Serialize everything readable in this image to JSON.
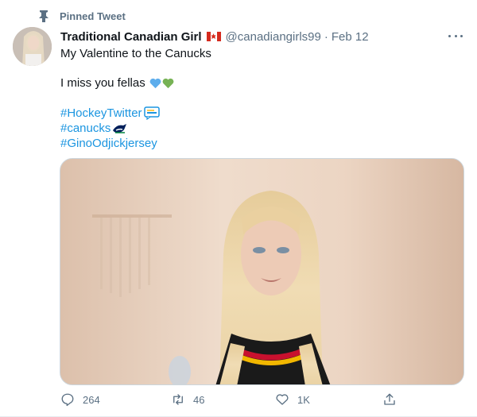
{
  "pinned": {
    "label": "Pinned Tweet",
    "icon": "pin-icon"
  },
  "author": {
    "display_name": "Traditional Canadian Girl",
    "flag": "🇨🇦",
    "handle": "@canadiangirls99",
    "separator": "·",
    "date": "Feb 12"
  },
  "tweet": {
    "line1": "My Valentine to the Canucks",
    "line2": "I miss you fellas",
    "hearts": [
      "blue-heart",
      "green-heart"
    ],
    "hashtags": [
      {
        "text": "#HockeyTwitter",
        "emoji": "hockey-twitter-emoji"
      },
      {
        "text": "#canucks",
        "emoji": "canucks-orca-emoji"
      },
      {
        "text": "#GinoOdjickjersey",
        "emoji": ""
      }
    ]
  },
  "actions": {
    "reply": "264",
    "retweet": "46",
    "like": "1K"
  },
  "colors": {
    "link": "#1b95e0",
    "secondary": "#5b7083",
    "blue_heart": "#5dadec",
    "green_heart": "#77b255"
  }
}
